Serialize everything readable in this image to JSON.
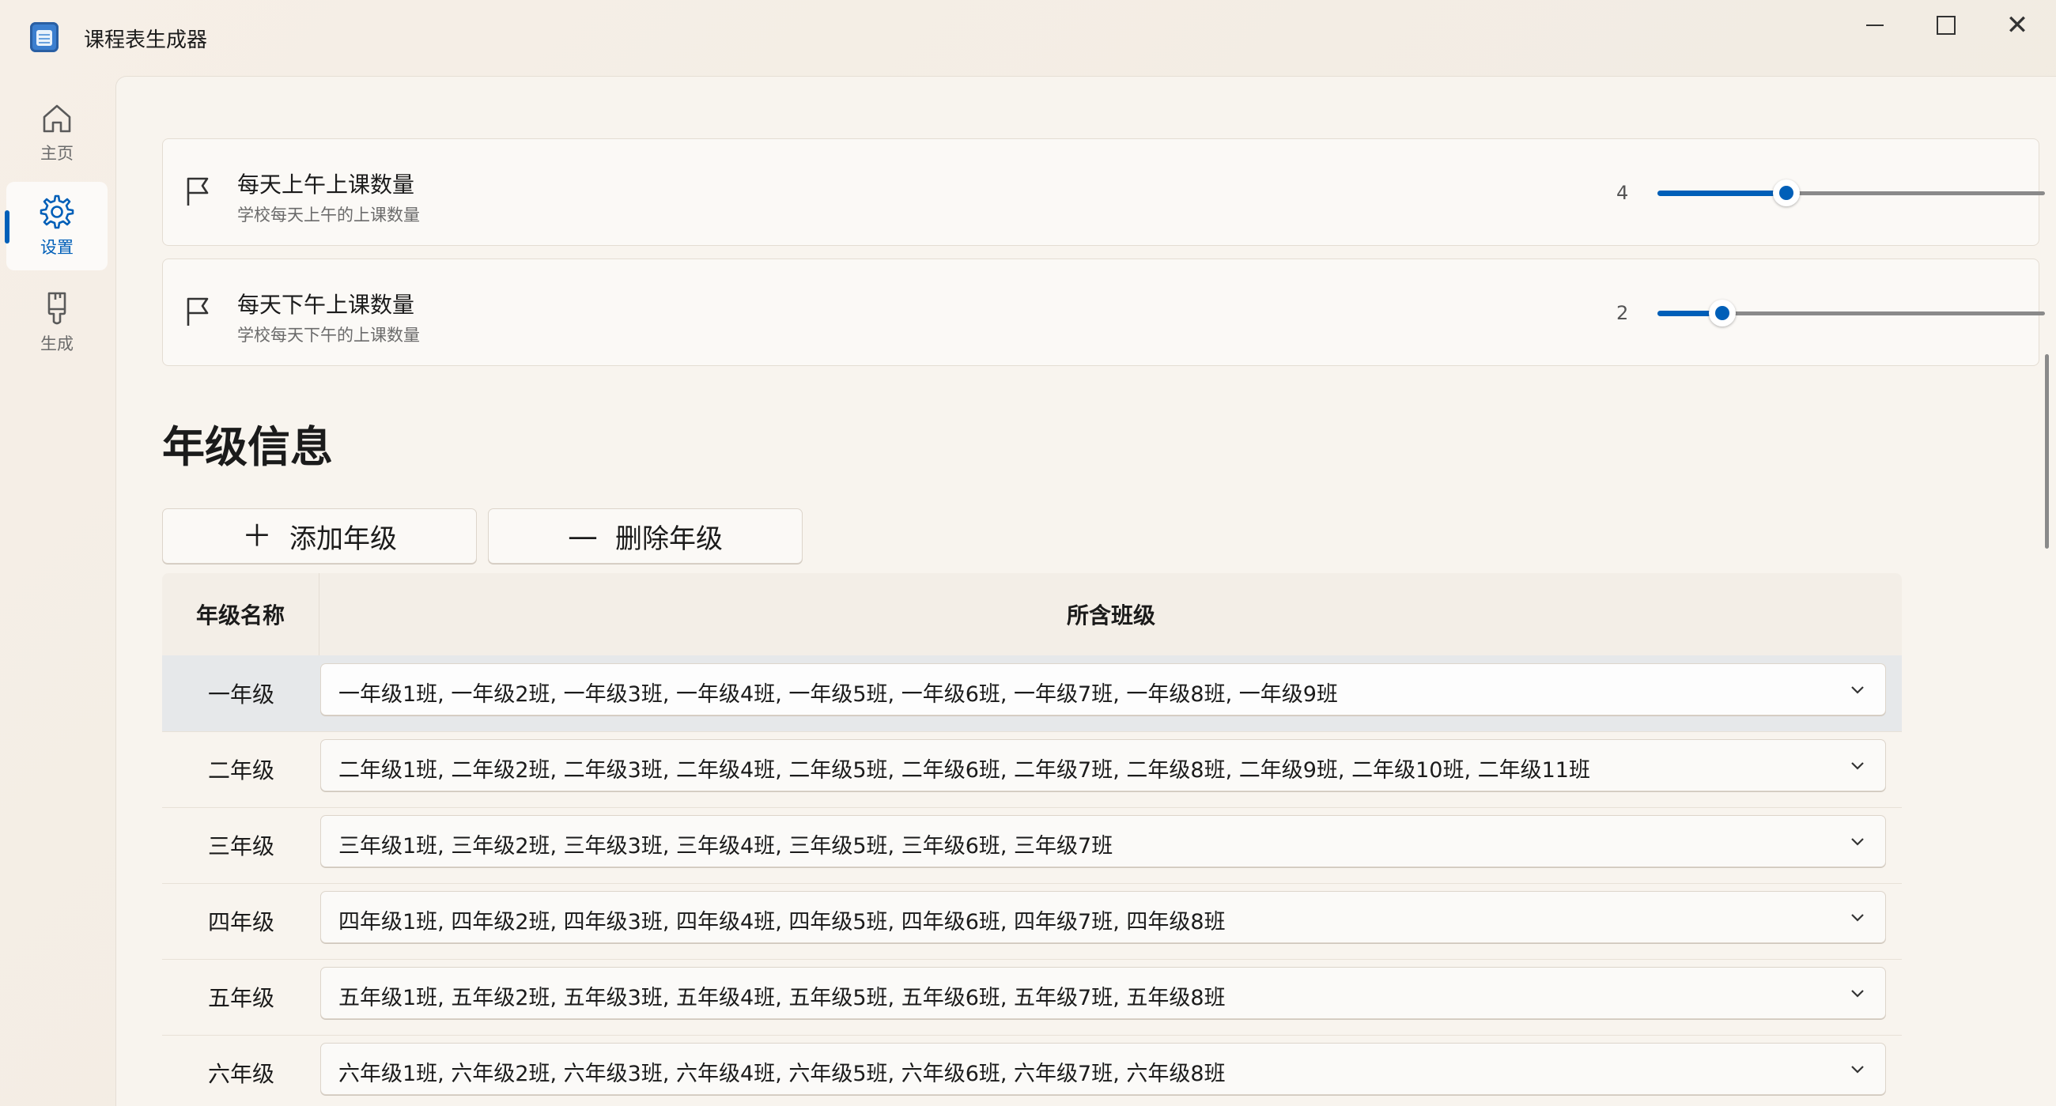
{
  "app": {
    "title": "课程表生成器"
  },
  "nav": {
    "items": [
      {
        "label": "主页",
        "icon": "home-icon"
      },
      {
        "label": "设置",
        "icon": "gear-icon",
        "active": true
      },
      {
        "label": "生成",
        "icon": "brush-icon"
      }
    ]
  },
  "settings": {
    "morning": {
      "title": "每天上午上课数量",
      "subtitle": "学校每天上午的上课数量",
      "value": "4",
      "min": 0,
      "max": 12
    },
    "afternoon": {
      "title": "每天下午上课数量",
      "subtitle": "学校每天下午的上课数量",
      "value": "2",
      "min": 0,
      "max": 12
    }
  },
  "grades_section": {
    "title": "年级信息",
    "add_label": "添加年级",
    "add_icon": "plus-icon",
    "delete_label": "删除年级",
    "delete_icon": "minus-icon",
    "col_name": "年级名称",
    "col_classes": "所含班级",
    "rows": [
      {
        "name": "一年级",
        "classes": "一年级1班, 一年级2班, 一年级3班, 一年级4班, 一年级5班, 一年级6班, 一年级7班, 一年级8班, 一年级9班"
      },
      {
        "name": "二年级",
        "classes": "二年级1班, 二年级2班, 二年级3班, 二年级4班, 二年级5班, 二年级6班, 二年级7班, 二年级8班, 二年级9班, 二年级10班, 二年级11班"
      },
      {
        "name": "三年级",
        "classes": "三年级1班, 三年级2班, 三年级3班, 三年级4班, 三年级5班, 三年级6班, 三年级7班"
      },
      {
        "name": "四年级",
        "classes": "四年级1班, 四年级2班, 四年级3班, 四年级4班, 四年级5班, 四年级6班, 四年级7班, 四年级8班"
      },
      {
        "name": "五年级",
        "classes": "五年级1班, 五年级2班, 五年级3班, 五年级4班, 五年级5班, 五年级6班, 五年级7班, 五年级8班"
      },
      {
        "name": "六年级",
        "classes": "六年级1班, 六年级2班, 六年级3班, 六年级4班, 六年级5班, 六年级6班, 六年级7班, 六年级8班"
      }
    ]
  },
  "colors": {
    "accent": "#005fb8"
  }
}
